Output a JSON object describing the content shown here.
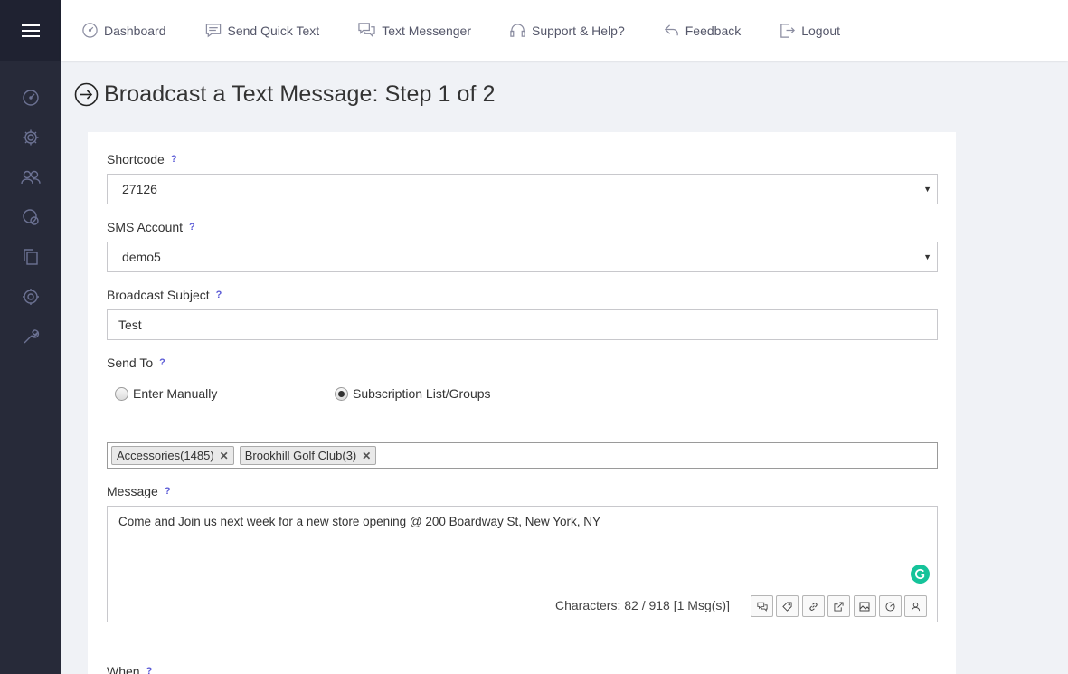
{
  "topnav": {
    "items": [
      {
        "label": "Dashboard",
        "icon": "dashboard-icon"
      },
      {
        "label": "Send Quick Text",
        "icon": "message-icon"
      },
      {
        "label": "Text Messenger",
        "icon": "chat-icon"
      },
      {
        "label": "Support & Help?",
        "icon": "headset-icon"
      },
      {
        "label": "Feedback",
        "icon": "reply-icon"
      },
      {
        "label": "Logout",
        "icon": "logout-icon"
      }
    ]
  },
  "sidebar": {
    "icons": [
      "gauge-icon",
      "gear-icon",
      "users-icon",
      "chat-bubbles-icon",
      "copy-icon",
      "settings-icon",
      "wrench-icon"
    ]
  },
  "page": {
    "title": "Broadcast a Text Message: Step 1 of 2"
  },
  "form": {
    "shortcode": {
      "label": "Shortcode",
      "help": "?",
      "value": "27126"
    },
    "sms_account": {
      "label": "SMS Account",
      "help": "?",
      "value": "demo5"
    },
    "subject": {
      "label": "Broadcast Subject",
      "help": "?",
      "value": "Test"
    },
    "send_to": {
      "label": "Send To",
      "help": "?",
      "options": [
        "Enter Manually",
        "Subscription List/Groups"
      ],
      "selected": "Subscription List/Groups"
    },
    "groups": [
      "Accessories(1485)",
      "Brookhill Golf Club(3)"
    ],
    "message": {
      "label": "Message",
      "help": "?",
      "value": "Come and Join us next week for a new store opening @ 200 Boardway St, New York, NY",
      "char_count": "Characters: 82 / 918 [1 Msg(s)]",
      "toolbar_icons": [
        "chat-icon",
        "tag-icon",
        "link-icon",
        "external-link-icon",
        "image-icon",
        "gauge-icon",
        "user-icon"
      ]
    },
    "when": {
      "label": "When",
      "help": "?"
    }
  },
  "colors": {
    "sidebar_bg": "#272a39",
    "menu_bg": "#1f2231",
    "page_bg": "#f0f2f6",
    "help_accent": "#5b5bd6",
    "grammarly": "#15c39a"
  }
}
